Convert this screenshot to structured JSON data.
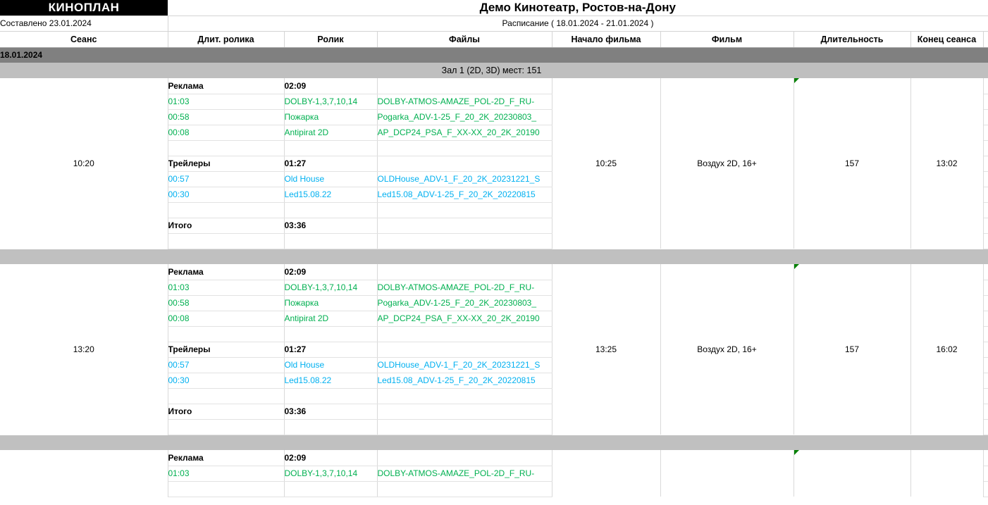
{
  "header": {
    "logo": "КИНОПЛАН",
    "title": "Демо Кинотеатр, Ростов-на-Дону",
    "compiled": "Составлено 23.01.2024",
    "schedule_range": "Расписание ( 18.01.2024 - 21.01.2024 )"
  },
  "columns": [
    "Сеанс",
    "Длит. ролика",
    "Ролик",
    "Файлы",
    "Начало фильма",
    "Фильм",
    "Длительность",
    "Конец сеанса"
  ],
  "date_band": "18.01.2024",
  "hall_band": "Зал 1 (2D, 3D) мест: 151",
  "labels": {
    "advertising": "Реклама",
    "trailers": "Трейлеры",
    "total": "Итого"
  },
  "colors": {
    "advertising": "#00b050",
    "trailers": "#00b0f0",
    "date_band": "#808080",
    "hall_band": "#bfbfbf",
    "separator": "#c0c0c0",
    "note_marker": "#008000"
  },
  "sessions": [
    {
      "seans": "10:20",
      "film_start": "10:25",
      "film": "Воздух 2D, 16+",
      "duration": "157",
      "session_end": "13:02",
      "has_note": true,
      "adv_total": "02:09",
      "trl_total": "01:27",
      "grand_total": "03:36",
      "adv": [
        {
          "len": "01:03",
          "name": "DOLBY-1,3,7,10,14",
          "file": "DOLBY-ATMOS-AMAZE_POL-2D_F_RU-"
        },
        {
          "len": "00:58",
          "name": "Пожарка",
          "file": "Pogarka_ADV-1-25_F_20_2K_20230803_"
        },
        {
          "len": "00:08",
          "name": "Antipirat 2D",
          "file": "AP_DCP24_PSA_F_XX-XX_20_2K_20190"
        }
      ],
      "trl": [
        {
          "len": "00:57",
          "name": "Old House",
          "file": "OLDHouse_ADV-1_F_20_2K_20231221_S"
        },
        {
          "len": "00:30",
          "name": "Led15.08.22",
          "file": "Led15.08_ADV-1-25_F_20_2K_20220815"
        }
      ]
    },
    {
      "seans": "13:20",
      "film_start": "13:25",
      "film": "Воздух 2D, 16+",
      "duration": "157",
      "session_end": "16:02",
      "has_note": true,
      "adv_total": "02:09",
      "trl_total": "01:27",
      "grand_total": "03:36",
      "adv": [
        {
          "len": "01:03",
          "name": "DOLBY-1,3,7,10,14",
          "file": "DOLBY-ATMOS-AMAZE_POL-2D_F_RU-"
        },
        {
          "len": "00:58",
          "name": "Пожарка",
          "file": "Pogarka_ADV-1-25_F_20_2K_20230803_"
        },
        {
          "len": "00:08",
          "name": "Antipirat 2D",
          "file": "AP_DCP24_PSA_F_XX-XX_20_2K_20190"
        }
      ],
      "trl": [
        {
          "len": "00:57",
          "name": "Old House",
          "file": "OLDHouse_ADV-1_F_20_2K_20231221_S"
        },
        {
          "len": "00:30",
          "name": "Led15.08.22",
          "file": "Led15.08_ADV-1-25_F_20_2K_20220815"
        }
      ]
    },
    {
      "seans": "",
      "film_start": "",
      "film": "",
      "duration": "",
      "session_end": "",
      "has_note": true,
      "adv_total": "02:09",
      "trl_total": "",
      "grand_total": "",
      "adv": [
        {
          "len": "01:03",
          "name": "DOLBY-1,3,7,10,14",
          "file": "DOLBY-ATMOS-AMAZE_POL-2D_F_RU-"
        }
      ],
      "trl": []
    }
  ]
}
